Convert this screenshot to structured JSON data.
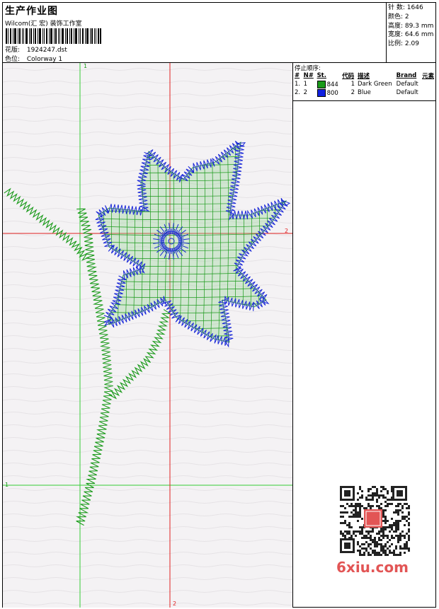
{
  "header": {
    "title": "生产作业图",
    "company": "Wilcom(汇 宏) 装饰工作室",
    "design_label": "花版:",
    "design_value": "1924247.dst",
    "colorway_label": "色位:",
    "colorway_value": "Colorway 1"
  },
  "stats": {
    "stitches_label": "针 数:",
    "stitches_value": "1646",
    "colors_label": "颜色:",
    "colors_value": "2",
    "height_label": "高度:",
    "height_value": "89.3 mm",
    "width_label": "宽度:",
    "width_value": "64.6 mm",
    "ratio_label": "比例:",
    "ratio_value": "2.09"
  },
  "stop_sequence": {
    "title": "停止顺序:",
    "columns": [
      "#",
      "N#",
      "St.",
      "代码",
      "描述",
      "Brand",
      "元素"
    ],
    "rows": [
      {
        "num": "1.",
        "needle": "1",
        "stitches": "844",
        "code": "1",
        "desc": "Dark Green",
        "brand": "Default",
        "color": "#1a9a1a"
      },
      {
        "num": "2.",
        "needle": "2",
        "stitches": "800",
        "code": "2",
        "desc": "Blue",
        "brand": "Default",
        "color": "#1020e0"
      }
    ]
  },
  "design_view": {
    "marker_1_top": "1",
    "marker_1_left": "1",
    "marker_2_right": "2",
    "marker_2_bottom": "2",
    "thread_green": "#1a9a1a",
    "thread_blue": "#1a28d8",
    "grid_green": "#33cc33",
    "grid_red": "#e02020"
  },
  "watermark": {
    "site": "6xiu.com"
  }
}
